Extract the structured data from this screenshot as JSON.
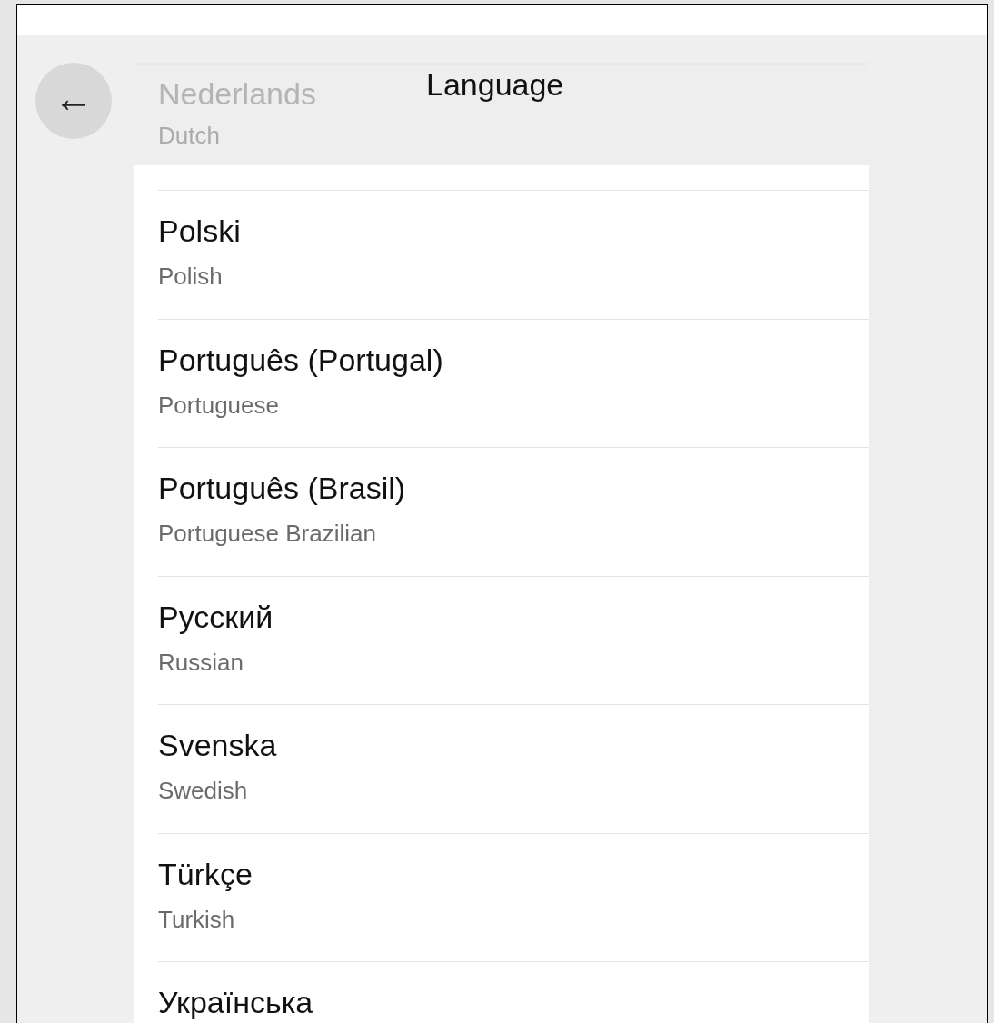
{
  "header": {
    "title": "Language",
    "back_button": "←"
  },
  "faded_item": {
    "title": "Nederlands",
    "subtitle": "Dutch"
  },
  "items": [
    {
      "title": "Polski",
      "subtitle": "Polish"
    },
    {
      "title": "Português (Portugal)",
      "subtitle": "Portuguese"
    },
    {
      "title": "Português (Brasil)",
      "subtitle": "Portuguese Brazilian"
    },
    {
      "title": "Русский",
      "subtitle": "Russian"
    },
    {
      "title": "Svenska",
      "subtitle": "Swedish"
    },
    {
      "title": "Türkçe",
      "subtitle": "Turkish"
    },
    {
      "title": "Українська"
    }
  ]
}
